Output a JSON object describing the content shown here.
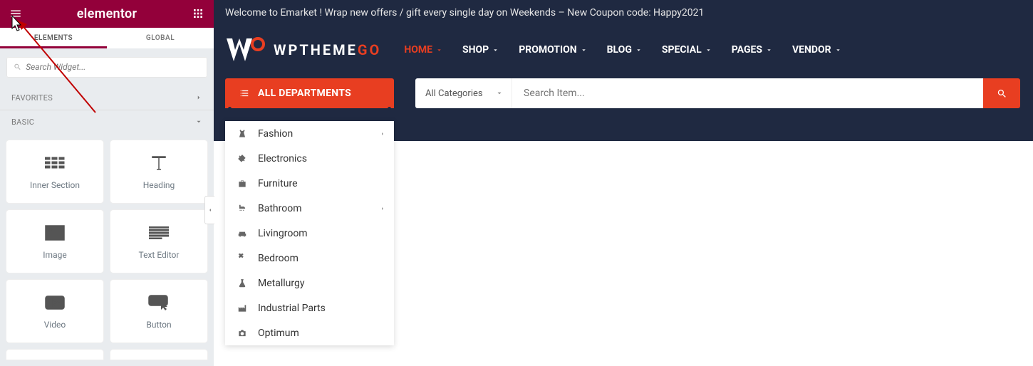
{
  "panel": {
    "title": "elementor",
    "tabs": {
      "elements": "ELEMENTS",
      "global": "GLOBAL"
    },
    "search_placeholder": "Search Widget...",
    "sections": {
      "favorites": "FAVORITES",
      "basic": "BASIC"
    },
    "widgets": {
      "inner_section": "Inner Section",
      "heading": "Heading",
      "image": "Image",
      "text_editor": "Text Editor",
      "video": "Video",
      "button": "Button"
    }
  },
  "site": {
    "announcement": "Welcome to Emarket ! Wrap new offers / gift every single day on Weekends – New Coupon code: Happy2021",
    "logo_main": "WPTHEME",
    "logo_suffix": "GO",
    "nav": {
      "home": "HOME",
      "shop": "SHOP",
      "promotion": "PROMOTION",
      "blog": "BLOG",
      "special": "SPECIAL",
      "pages": "PAGES",
      "vendor": "VENDOR"
    },
    "dept_button": "ALL DEPARTMENTS",
    "departments": [
      "Fashion",
      "Electronics",
      "Furniture",
      "Bathroom",
      "Livingroom",
      "Bedroom",
      "Metallurgy",
      "Industrial Parts",
      "Optimum"
    ],
    "category_select": "All Categories",
    "search_placeholder": "Search Item...",
    "colors": {
      "accent": "#e83e21",
      "panel_brand": "#93003a",
      "header_bg": "#1f2941"
    }
  }
}
